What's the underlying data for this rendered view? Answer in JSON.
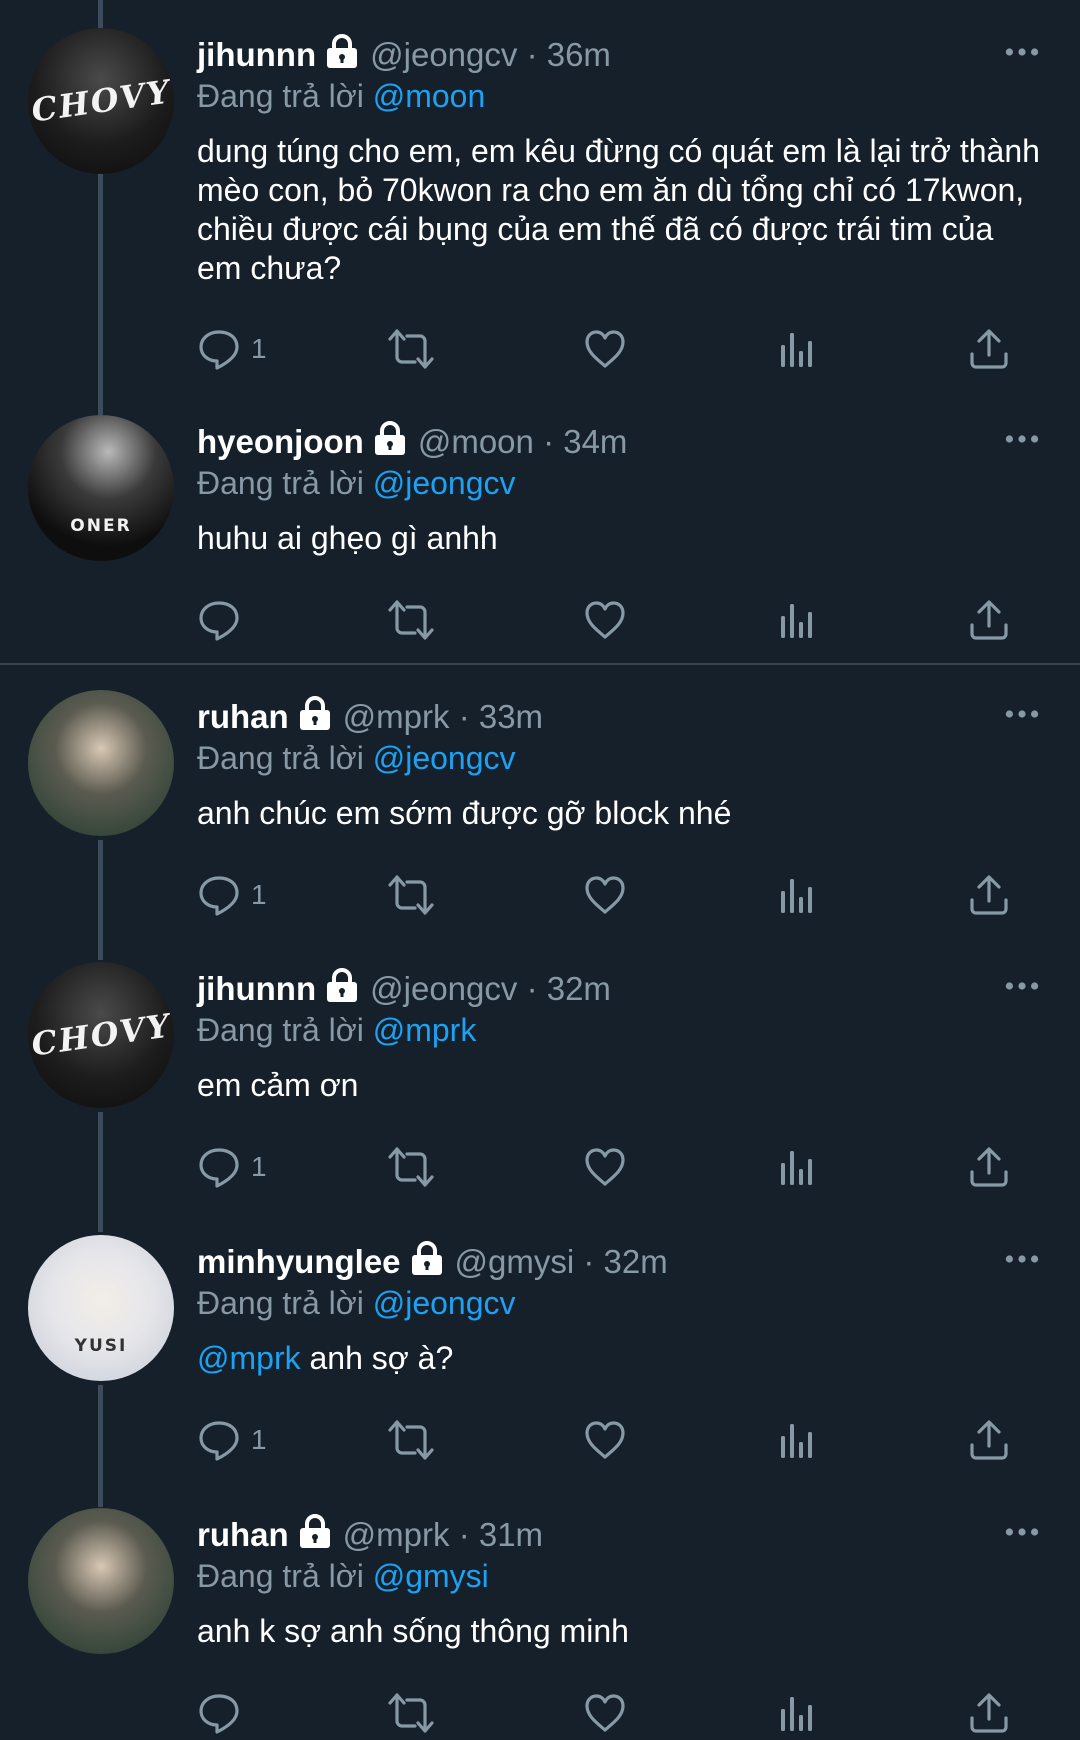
{
  "labels": {
    "replying_to": "Đang trả lời"
  },
  "colors": {
    "background": "#15202b",
    "mention": "#1da1f2",
    "muted": "#8899a6",
    "thread_line": "#3d4c5c"
  },
  "tweets": [
    {
      "display_name": "jihunnn",
      "handle": "@jeongcv",
      "time": "· 36m",
      "reply_to": "@moon",
      "text": "dung túng cho em, em kêu đừng có quát em là lại trở thành mèo con, bỏ 70kwon ra cho em ăn dù tổng chỉ có 17kwon, chiều được cái bụng của em thế đã có được trái tim của em chưa?",
      "avatar_text": "CHOVY",
      "reply_count": "1",
      "icons": [
        "lock-icon",
        "more-icon",
        "reply-icon",
        "retweet-icon",
        "like-icon",
        "analytics-icon",
        "share-icon"
      ]
    },
    {
      "display_name": "hyeonjoon",
      "handle": "@moon",
      "time": "· 34m",
      "reply_to": "@jeongcv",
      "text": "huhu ai ghẹo gì anhh",
      "avatar_text": "ONER",
      "reply_count": ""
    },
    {
      "display_name": "ruhan",
      "handle": "@mprk",
      "time": "· 33m",
      "reply_to": "@jeongcv",
      "text": "anh chúc em sớm được gỡ block nhé",
      "avatar_text": "",
      "reply_count": "1"
    },
    {
      "display_name": "jihunnn",
      "handle": "@jeongcv",
      "time": "· 32m",
      "reply_to": "@mprk",
      "text": "em cảm ơn",
      "avatar_text": "CHOVY",
      "reply_count": "1"
    },
    {
      "display_name": "minhyunglee",
      "handle": "@gmysi",
      "time": "· 32m",
      "reply_to": "@jeongcv",
      "text_mention": "@mprk",
      "text": " anh sợ à?",
      "avatar_text": "YUSI",
      "reply_count": "1"
    },
    {
      "display_name": "ruhan",
      "handle": "@mprk",
      "time": "· 31m",
      "reply_to": "@gmysi",
      "text": "anh k sợ anh sống thông minh",
      "avatar_text": "",
      "reply_count": ""
    }
  ]
}
